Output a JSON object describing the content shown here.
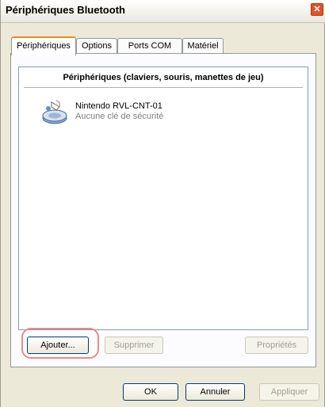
{
  "window": {
    "title": "Périphériques Bluetooth"
  },
  "tabs": [
    {
      "label": "Périphériques"
    },
    {
      "label": "Options"
    },
    {
      "label": "Ports COM"
    },
    {
      "label": "Matériel"
    }
  ],
  "device_list": {
    "header": "Périphériques (claviers, souris, manettes de jeu)",
    "devices": [
      {
        "name": "Nintendo RVL-CNT-01",
        "status": "Aucune clé de sécurité",
        "icon": "bluetooth-device-icon"
      }
    ]
  },
  "panel_buttons": {
    "add": "Ajouter...",
    "remove": "Supprimer",
    "properties": "Propriétés"
  },
  "dialog_buttons": {
    "ok": "OK",
    "cancel": "Annuler",
    "apply": "Appliquer"
  },
  "colors": {
    "highlight": "#e88a8a",
    "active_tab_accent": "#e68b2c",
    "close_button": "#e0532b"
  }
}
